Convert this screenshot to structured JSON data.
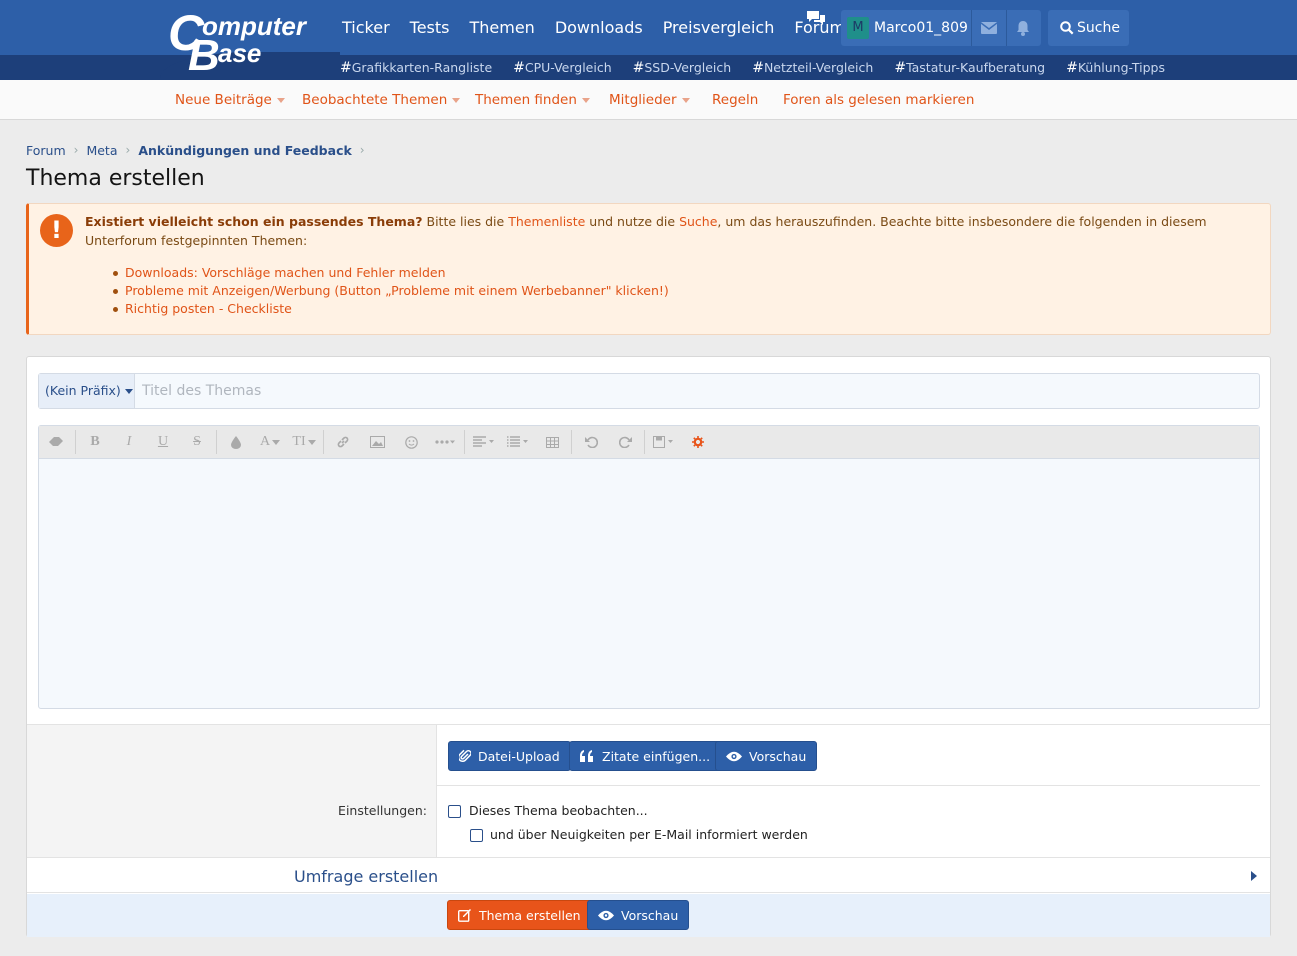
{
  "brand": {
    "logo_line1": "omputer",
    "logo_line2": "ase",
    "logo_letter1": "C",
    "logo_letter2": "B"
  },
  "nav": {
    "items": [
      "Ticker",
      "Tests",
      "Themen",
      "Downloads",
      "Preisvergleich",
      "Forum"
    ],
    "user": {
      "avatar": "M",
      "name": "Marco01_809"
    },
    "search_label": "Suche"
  },
  "tags": [
    "Grafikkarten-Rangliste",
    "CPU-Vergleich",
    "SSD-Vergleich",
    "Netzteil-Vergleich",
    "Tastatur-Kaufberatung",
    "Kühlung-Tipps"
  ],
  "subnav": {
    "items": [
      "Neue Beiträge",
      "Beobachtete Themen",
      "Themen finden",
      "Mitglieder",
      "Regeln",
      "Foren als gelesen markieren"
    ]
  },
  "breadcrumb": [
    "Forum",
    "Meta",
    "Ankündigungen und Feedback"
  ],
  "page_title": "Thema erstellen",
  "notice": {
    "question": "Existiert vielleicht schon ein passendes Thema?",
    "text1": " Bitte lies die ",
    "link1": "Themenliste",
    "text2": " und nutze die ",
    "link2": "Suche",
    "text3": ", um das herauszufinden. Beachte bitte insbesondere die folgenden in diesem Unterforum festgepinnten Themen:",
    "pinned": [
      "Downloads: Vorschläge machen und Fehler melden",
      "Probleme mit Anzeigen/Werbung (Button „Probleme mit einem Werbebanner\" klicken!)",
      "Richtig posten - Checkliste"
    ]
  },
  "form": {
    "prefix": "(Kein Präfix)",
    "title_placeholder": "Titel des Themas",
    "buttons": {
      "upload": "Datei-Upload",
      "quotes": "Zitate einfügen...",
      "preview": "Vorschau"
    },
    "settings_label": "Einstellungen:",
    "watch": "Dieses Thema beobachten...",
    "email": "und über Neuigkeiten per E-Mail informiert werden",
    "poll": "Umfrage erstellen",
    "submit": "Thema erstellen",
    "preview2": "Vorschau"
  },
  "colors": {
    "header_blue": "#2d5fa8",
    "accent_orange": "#e05418",
    "button_blue": "#2d5fa8",
    "submit_orange": "#e8541a"
  },
  "icons": [
    "forum-chat-icon",
    "mail-icon",
    "bell-icon",
    "search-icon",
    "alert-icon",
    "paperclip-icon",
    "quote-icon",
    "eye-icon",
    "edit-icon"
  ]
}
